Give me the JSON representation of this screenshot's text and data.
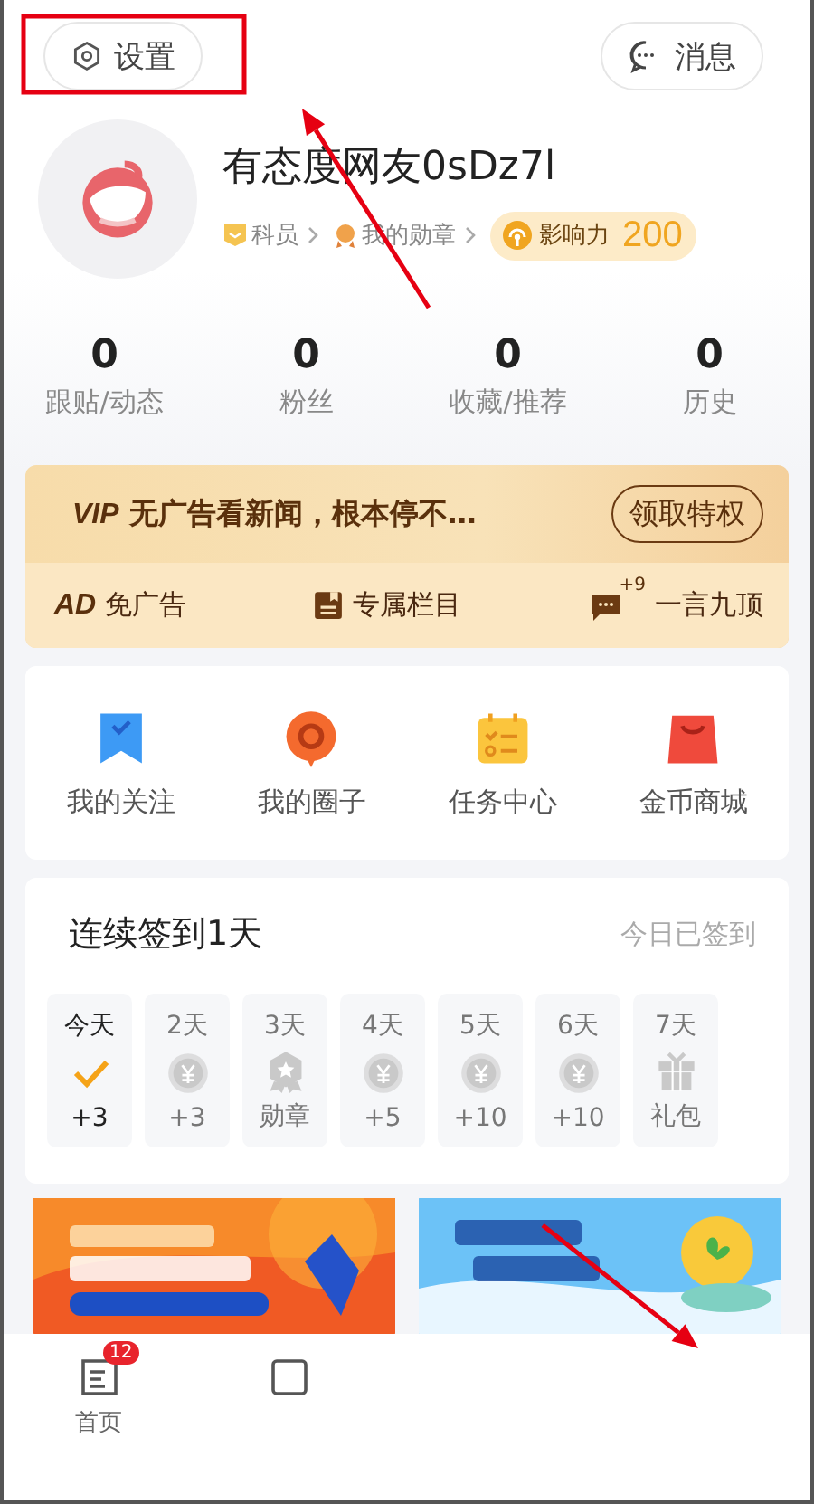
{
  "top_bar": {
    "settings_button": {
      "label": "设置"
    },
    "messages_button": {
      "label": "消息"
    }
  },
  "profile": {
    "name": "有态度网友0sDz7l",
    "level": "科员",
    "medals": "我的勋章",
    "influence": {
      "label": "影响力",
      "value": "200"
    }
  },
  "stats": [
    {
      "value": "0",
      "label": "跟贴/动态"
    },
    {
      "value": "0",
      "label": "粉丝"
    },
    {
      "value": "0",
      "label": "收藏/推荐"
    },
    {
      "value": "0",
      "label": "历史"
    }
  ],
  "vip": {
    "tag": "VIP",
    "headline": "无广告看新闻，根本停不…",
    "button": "领取特权",
    "perks": [
      {
        "kind": "ad",
        "mark": "AD",
        "label": "免广告"
      },
      {
        "kind": "column",
        "label": "专属栏目"
      },
      {
        "kind": "top",
        "badge": "+9",
        "label": "一言九顶"
      }
    ]
  },
  "shortcuts": [
    {
      "kind": "follow",
      "label": "我的关注"
    },
    {
      "kind": "circle",
      "label": "我的圈子"
    },
    {
      "kind": "tasks",
      "label": "任务中心"
    },
    {
      "kind": "shop",
      "label": "金币商城"
    }
  ],
  "checkin": {
    "title": "连续签到1天",
    "status": "今日已签到",
    "days": [
      {
        "label": "今天",
        "kind": "check",
        "reward": "+3",
        "done": true
      },
      {
        "label": "2天",
        "kind": "coin",
        "reward": "+3",
        "done": false
      },
      {
        "label": "3天",
        "kind": "medal",
        "reward": "勋章",
        "done": false
      },
      {
        "label": "4天",
        "kind": "coin",
        "reward": "+5",
        "done": false
      },
      {
        "label": "5天",
        "kind": "coin",
        "reward": "+10",
        "done": false
      },
      {
        "label": "6天",
        "kind": "coin",
        "reward": "+10",
        "done": false
      },
      {
        "label": "7天",
        "kind": "gift",
        "reward": "礼包",
        "done": false
      }
    ]
  },
  "nav": [
    {
      "kind": "news",
      "label": "首页",
      "badge": "12"
    },
    {
      "kind": "video"
    }
  ],
  "annotations": [
    {
      "kind": "frame"
    },
    {
      "kind": "arrow"
    },
    {
      "kind": "arrow"
    }
  ]
}
